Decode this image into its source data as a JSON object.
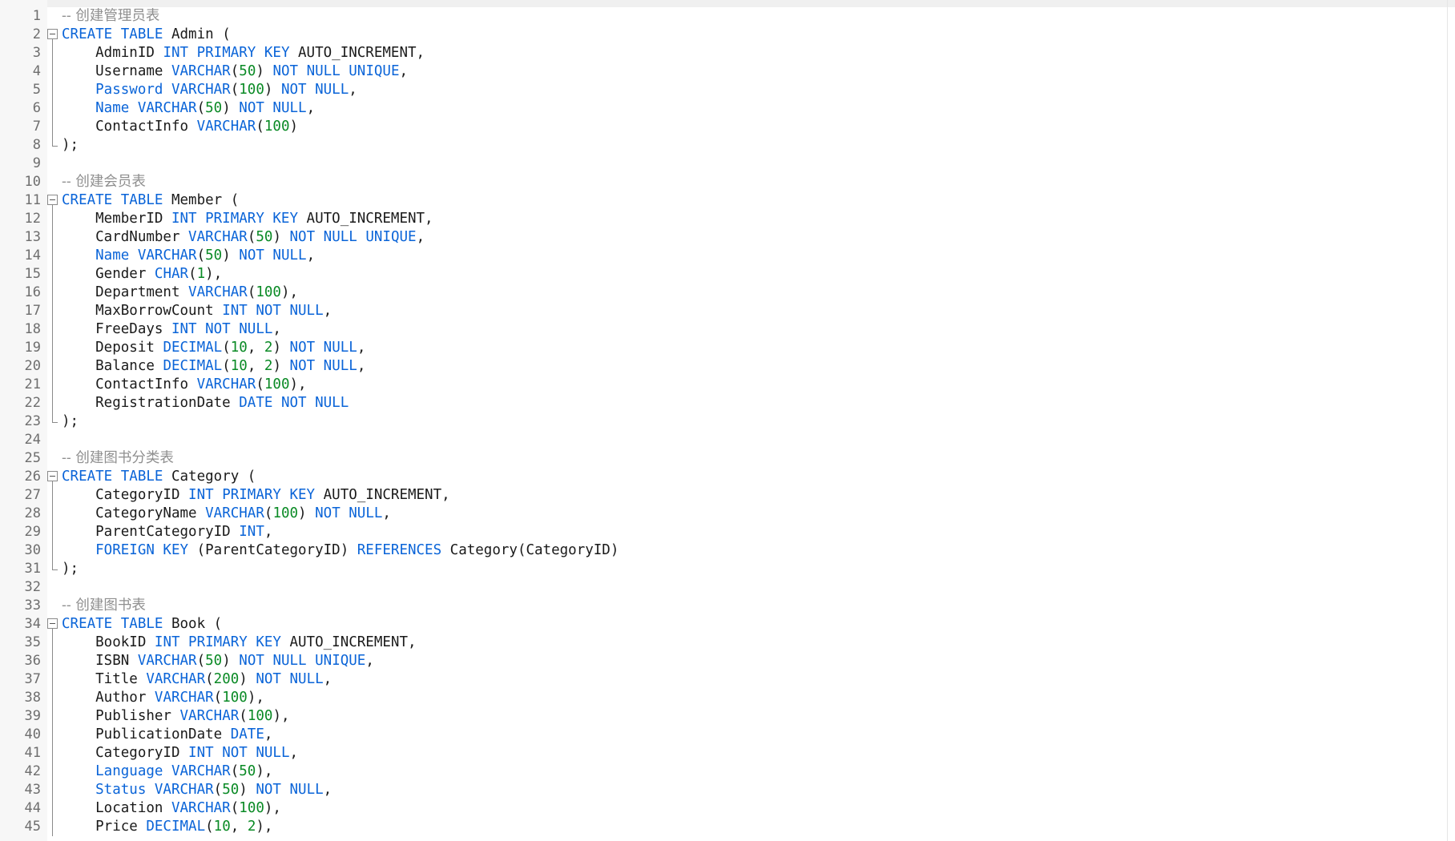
{
  "editor": {
    "colors": {
      "keyword": "#0a64d8",
      "number": "#0a8a25",
      "comment": "#8f8f8f",
      "identifier": "#1a1a1a",
      "line_number": "#6e6e6e",
      "gutter": "#f7f7f7"
    },
    "icons": {
      "fold_open": "fold-collapse-icon",
      "fold_end": "fold-end-icon"
    },
    "lines": [
      {
        "n": "1",
        "fold": "none",
        "tokens": [
          [
            "c",
            "-- 创建管理员表"
          ]
        ]
      },
      {
        "n": "2",
        "fold": "start",
        "tokens": [
          [
            "k",
            "CREATE TABLE"
          ],
          [
            "t",
            " Admin ("
          ]
        ]
      },
      {
        "n": "3",
        "fold": "body",
        "tokens": [
          [
            "t",
            "    AdminID "
          ],
          [
            "k",
            "INT PRIMARY KEY"
          ],
          [
            "t",
            " AUTO_INCREMENT,"
          ]
        ]
      },
      {
        "n": "4",
        "fold": "body",
        "tokens": [
          [
            "t",
            "    Username "
          ],
          [
            "k",
            "VARCHAR"
          ],
          [
            "t",
            "("
          ],
          [
            "n",
            "50"
          ],
          [
            "t",
            ") "
          ],
          [
            "k",
            "NOT NULL UNIQUE"
          ],
          [
            "t",
            ","
          ]
        ]
      },
      {
        "n": "5",
        "fold": "body",
        "tokens": [
          [
            "k",
            "    Password VARCHAR"
          ],
          [
            "t",
            "("
          ],
          [
            "n",
            "100"
          ],
          [
            "t",
            ") "
          ],
          [
            "k",
            "NOT NULL"
          ],
          [
            "t",
            ","
          ]
        ]
      },
      {
        "n": "6",
        "fold": "body",
        "tokens": [
          [
            "k",
            "    Name VARCHAR"
          ],
          [
            "t",
            "("
          ],
          [
            "n",
            "50"
          ],
          [
            "t",
            ") "
          ],
          [
            "k",
            "NOT NULL"
          ],
          [
            "t",
            ","
          ]
        ]
      },
      {
        "n": "7",
        "fold": "body",
        "tokens": [
          [
            "t",
            "    ContactInfo "
          ],
          [
            "k",
            "VARCHAR"
          ],
          [
            "t",
            "("
          ],
          [
            "n",
            "100"
          ],
          [
            "t",
            ")"
          ]
        ]
      },
      {
        "n": "8",
        "fold": "end",
        "tokens": [
          [
            "t",
            ");"
          ]
        ]
      },
      {
        "n": "9",
        "fold": "none",
        "tokens": []
      },
      {
        "n": "10",
        "fold": "none",
        "tokens": [
          [
            "c",
            "-- 创建会员表"
          ]
        ]
      },
      {
        "n": "11",
        "fold": "start",
        "tokens": [
          [
            "k",
            "CREATE TABLE"
          ],
          [
            "t",
            " Member ("
          ]
        ]
      },
      {
        "n": "12",
        "fold": "body",
        "tokens": [
          [
            "t",
            "    MemberID "
          ],
          [
            "k",
            "INT PRIMARY KEY"
          ],
          [
            "t",
            " AUTO_INCREMENT,"
          ]
        ]
      },
      {
        "n": "13",
        "fold": "body",
        "tokens": [
          [
            "t",
            "    CardNumber "
          ],
          [
            "k",
            "VARCHAR"
          ],
          [
            "t",
            "("
          ],
          [
            "n",
            "50"
          ],
          [
            "t",
            ") "
          ],
          [
            "k",
            "NOT NULL UNIQUE"
          ],
          [
            "t",
            ","
          ]
        ]
      },
      {
        "n": "14",
        "fold": "body",
        "tokens": [
          [
            "k",
            "    Name VARCHAR"
          ],
          [
            "t",
            "("
          ],
          [
            "n",
            "50"
          ],
          [
            "t",
            ") "
          ],
          [
            "k",
            "NOT NULL"
          ],
          [
            "t",
            ","
          ]
        ]
      },
      {
        "n": "15",
        "fold": "body",
        "tokens": [
          [
            "t",
            "    Gender "
          ],
          [
            "k",
            "CHAR"
          ],
          [
            "t",
            "("
          ],
          [
            "n",
            "1"
          ],
          [
            "t",
            "),"
          ]
        ]
      },
      {
        "n": "16",
        "fold": "body",
        "tokens": [
          [
            "t",
            "    Department "
          ],
          [
            "k",
            "VARCHAR"
          ],
          [
            "t",
            "("
          ],
          [
            "n",
            "100"
          ],
          [
            "t",
            "),"
          ]
        ]
      },
      {
        "n": "17",
        "fold": "body",
        "tokens": [
          [
            "t",
            "    MaxBorrowCount "
          ],
          [
            "k",
            "INT NOT NULL"
          ],
          [
            "t",
            ","
          ]
        ]
      },
      {
        "n": "18",
        "fold": "body",
        "tokens": [
          [
            "t",
            "    FreeDays "
          ],
          [
            "k",
            "INT NOT NULL"
          ],
          [
            "t",
            ","
          ]
        ]
      },
      {
        "n": "19",
        "fold": "body",
        "tokens": [
          [
            "t",
            "    Deposit "
          ],
          [
            "k",
            "DECIMAL"
          ],
          [
            "t",
            "("
          ],
          [
            "n",
            "10"
          ],
          [
            "t",
            ", "
          ],
          [
            "n",
            "2"
          ],
          [
            "t",
            ") "
          ],
          [
            "k",
            "NOT NULL"
          ],
          [
            "t",
            ","
          ]
        ]
      },
      {
        "n": "20",
        "fold": "body",
        "tokens": [
          [
            "t",
            "    Balance "
          ],
          [
            "k",
            "DECIMAL"
          ],
          [
            "t",
            "("
          ],
          [
            "n",
            "10"
          ],
          [
            "t",
            ", "
          ],
          [
            "n",
            "2"
          ],
          [
            "t",
            ") "
          ],
          [
            "k",
            "NOT NULL"
          ],
          [
            "t",
            ","
          ]
        ]
      },
      {
        "n": "21",
        "fold": "body",
        "tokens": [
          [
            "t",
            "    ContactInfo "
          ],
          [
            "k",
            "VARCHAR"
          ],
          [
            "t",
            "("
          ],
          [
            "n",
            "100"
          ],
          [
            "t",
            "),"
          ]
        ]
      },
      {
        "n": "22",
        "fold": "body",
        "tokens": [
          [
            "t",
            "    RegistrationDate "
          ],
          [
            "k",
            "DATE NOT NULL"
          ]
        ]
      },
      {
        "n": "23",
        "fold": "end",
        "tokens": [
          [
            "t",
            ");"
          ]
        ]
      },
      {
        "n": "24",
        "fold": "none",
        "tokens": []
      },
      {
        "n": "25",
        "fold": "none",
        "tokens": [
          [
            "c",
            "-- 创建图书分类表"
          ]
        ]
      },
      {
        "n": "26",
        "fold": "start",
        "tokens": [
          [
            "k",
            "CREATE TABLE"
          ],
          [
            "t",
            " Category ("
          ]
        ]
      },
      {
        "n": "27",
        "fold": "body",
        "tokens": [
          [
            "t",
            "    CategoryID "
          ],
          [
            "k",
            "INT PRIMARY KEY"
          ],
          [
            "t",
            " AUTO_INCREMENT,"
          ]
        ]
      },
      {
        "n": "28",
        "fold": "body",
        "tokens": [
          [
            "t",
            "    CategoryName "
          ],
          [
            "k",
            "VARCHAR"
          ],
          [
            "t",
            "("
          ],
          [
            "n",
            "100"
          ],
          [
            "t",
            ") "
          ],
          [
            "k",
            "NOT NULL"
          ],
          [
            "t",
            ","
          ]
        ]
      },
      {
        "n": "29",
        "fold": "body",
        "tokens": [
          [
            "t",
            "    ParentCategoryID "
          ],
          [
            "k",
            "INT"
          ],
          [
            "t",
            ","
          ]
        ]
      },
      {
        "n": "30",
        "fold": "body",
        "tokens": [
          [
            "k",
            "    FOREIGN KEY"
          ],
          [
            "t",
            " (ParentCategoryID) "
          ],
          [
            "k",
            "REFERENCES"
          ],
          [
            "t",
            " Category(CategoryID)"
          ]
        ]
      },
      {
        "n": "31",
        "fold": "end",
        "tokens": [
          [
            "t",
            ");"
          ]
        ]
      },
      {
        "n": "32",
        "fold": "none",
        "tokens": []
      },
      {
        "n": "33",
        "fold": "none",
        "tokens": [
          [
            "c",
            "-- 创建图书表"
          ]
        ]
      },
      {
        "n": "34",
        "fold": "start",
        "tokens": [
          [
            "k",
            "CREATE TABLE"
          ],
          [
            "t",
            " Book ("
          ]
        ]
      },
      {
        "n": "35",
        "fold": "body",
        "tokens": [
          [
            "t",
            "    BookID "
          ],
          [
            "k",
            "INT PRIMARY KEY"
          ],
          [
            "t",
            " AUTO_INCREMENT,"
          ]
        ]
      },
      {
        "n": "36",
        "fold": "body",
        "tokens": [
          [
            "t",
            "    ISBN "
          ],
          [
            "k",
            "VARCHAR"
          ],
          [
            "t",
            "("
          ],
          [
            "n",
            "50"
          ],
          [
            "t",
            ") "
          ],
          [
            "k",
            "NOT NULL UNIQUE"
          ],
          [
            "t",
            ","
          ]
        ]
      },
      {
        "n": "37",
        "fold": "body",
        "tokens": [
          [
            "t",
            "    Title "
          ],
          [
            "k",
            "VARCHAR"
          ],
          [
            "t",
            "("
          ],
          [
            "n",
            "200"
          ],
          [
            "t",
            ") "
          ],
          [
            "k",
            "NOT NULL"
          ],
          [
            "t",
            ","
          ]
        ]
      },
      {
        "n": "38",
        "fold": "body",
        "tokens": [
          [
            "t",
            "    Author "
          ],
          [
            "k",
            "VARCHAR"
          ],
          [
            "t",
            "("
          ],
          [
            "n",
            "100"
          ],
          [
            "t",
            "),"
          ]
        ]
      },
      {
        "n": "39",
        "fold": "body",
        "tokens": [
          [
            "t",
            "    Publisher "
          ],
          [
            "k",
            "VARCHAR"
          ],
          [
            "t",
            "("
          ],
          [
            "n",
            "100"
          ],
          [
            "t",
            "),"
          ]
        ]
      },
      {
        "n": "40",
        "fold": "body",
        "tokens": [
          [
            "t",
            "    PublicationDate "
          ],
          [
            "k",
            "DATE"
          ],
          [
            "t",
            ","
          ]
        ]
      },
      {
        "n": "41",
        "fold": "body",
        "tokens": [
          [
            "t",
            "    CategoryID "
          ],
          [
            "k",
            "INT NOT NULL"
          ],
          [
            "t",
            ","
          ]
        ]
      },
      {
        "n": "42",
        "fold": "body",
        "tokens": [
          [
            "k",
            "    Language VARCHAR"
          ],
          [
            "t",
            "("
          ],
          [
            "n",
            "50"
          ],
          [
            "t",
            "),"
          ]
        ]
      },
      {
        "n": "43",
        "fold": "body",
        "tokens": [
          [
            "k",
            "    Status VARCHAR"
          ],
          [
            "t",
            "("
          ],
          [
            "n",
            "50"
          ],
          [
            "t",
            ") "
          ],
          [
            "k",
            "NOT NULL"
          ],
          [
            "t",
            ","
          ]
        ]
      },
      {
        "n": "44",
        "fold": "body",
        "tokens": [
          [
            "t",
            "    Location "
          ],
          [
            "k",
            "VARCHAR"
          ],
          [
            "t",
            "("
          ],
          [
            "n",
            "100"
          ],
          [
            "t",
            "),"
          ]
        ]
      },
      {
        "n": "45",
        "fold": "body",
        "tokens": [
          [
            "t",
            "    Price "
          ],
          [
            "k",
            "DECIMAL"
          ],
          [
            "t",
            "("
          ],
          [
            "n",
            "10"
          ],
          [
            "t",
            ", "
          ],
          [
            "n",
            "2"
          ],
          [
            "t",
            "),"
          ]
        ]
      }
    ]
  }
}
